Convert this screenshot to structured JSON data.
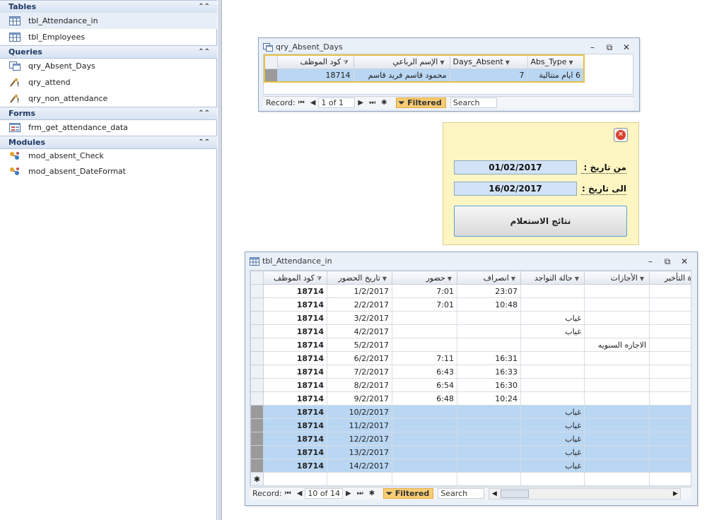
{
  "nav": {
    "groups": [
      {
        "title": "Tables",
        "items": [
          {
            "label": "tbl_Attendance_in",
            "icon": "table-icon"
          },
          {
            "label": "tbl_Employees",
            "icon": "table-icon"
          }
        ]
      },
      {
        "title": "Queries",
        "items": [
          {
            "label": "qry_Absent_Days",
            "icon": "select-query-icon"
          },
          {
            "label": "qry_attend",
            "icon": "action-query-icon"
          },
          {
            "label": "qry_non_attendance",
            "icon": "action-query-icon"
          }
        ]
      },
      {
        "title": "Forms",
        "items": [
          {
            "label": "frm_get_attendance_data",
            "icon": "form-icon"
          }
        ]
      },
      {
        "title": "Modules",
        "items": [
          {
            "label": "mod_absent_Check",
            "icon": "module-icon"
          },
          {
            "label": "mod_absent_DateFormat",
            "icon": "module-icon"
          }
        ]
      }
    ]
  },
  "query_window": {
    "title": "qry_Absent_Days",
    "columns": [
      "كود الموظف",
      "الإسم الرباعي",
      "Days_Absent",
      "Abs_Type"
    ],
    "rows": [
      [
        "18714",
        "محمود قاسم فريد قاسم",
        "7",
        "6 ايام متتالية"
      ]
    ],
    "record_label": "Record:",
    "record_position": "1 of 1",
    "filtered_label": "Filtered",
    "search_label": "Search"
  },
  "form": {
    "from_label": "من تاريخ :",
    "from_value": "01/02/2017",
    "to_label": "الى تاريخ :",
    "to_value": "16/02/2017",
    "run_button": "نتائج الاستعلام"
  },
  "table_window": {
    "title": "tbl_Attendance_in",
    "columns": [
      "كود الموظف",
      "تاريخ الحضور",
      "حضور",
      "انصراف",
      "حالة التواجد",
      "الأجازات",
      "مدة التأخير"
    ],
    "rows": [
      [
        "18714",
        "1/2/2017",
        "7:01",
        "23:07",
        "",
        "",
        ""
      ],
      [
        "18714",
        "2/2/2017",
        "7:01",
        "10:48",
        "",
        "",
        ""
      ],
      [
        "18714",
        "3/2/2017",
        "",
        "",
        "غياب",
        "",
        ""
      ],
      [
        "18714",
        "4/2/2017",
        "",
        "",
        "غياب",
        "",
        ""
      ],
      [
        "18714",
        "5/2/2017",
        "",
        "",
        "",
        "الاجازه السنويه",
        ""
      ],
      [
        "18714",
        "6/2/2017",
        "7:11",
        "16:31",
        "",
        "",
        ""
      ],
      [
        "18714",
        "7/2/2017",
        "6:43",
        "16:33",
        "",
        "",
        ""
      ],
      [
        "18714",
        "8/2/2017",
        "6:54",
        "16:30",
        "",
        "",
        ""
      ],
      [
        "18714",
        "9/2/2017",
        "6:48",
        "10:24",
        "",
        "",
        ""
      ],
      [
        "18714",
        "10/2/2017",
        "",
        "",
        "غياب",
        "",
        ""
      ],
      [
        "18714",
        "11/2/2017",
        "",
        "",
        "غياب",
        "",
        ""
      ],
      [
        "18714",
        "12/2/2017",
        "",
        "",
        "غياب",
        "",
        ""
      ],
      [
        "18714",
        "13/2/2017",
        "",
        "",
        "غياب",
        "",
        ""
      ],
      [
        "18714",
        "14/2/2017",
        "",
        "",
        "غياب",
        "",
        ""
      ]
    ],
    "highlighted_rows": [
      9,
      10,
      11,
      12,
      13
    ],
    "new_row_marker": "✱",
    "record_label": "Record:",
    "record_position": "10 of 14",
    "filtered_label": "Filtered",
    "search_label": "Search"
  },
  "colors": {
    "selection_blue": "#b9d6f2",
    "form_background": "#fdf6c3",
    "filtered_badge": "#f8cc73",
    "nav_header_text": "#1f3a66"
  }
}
